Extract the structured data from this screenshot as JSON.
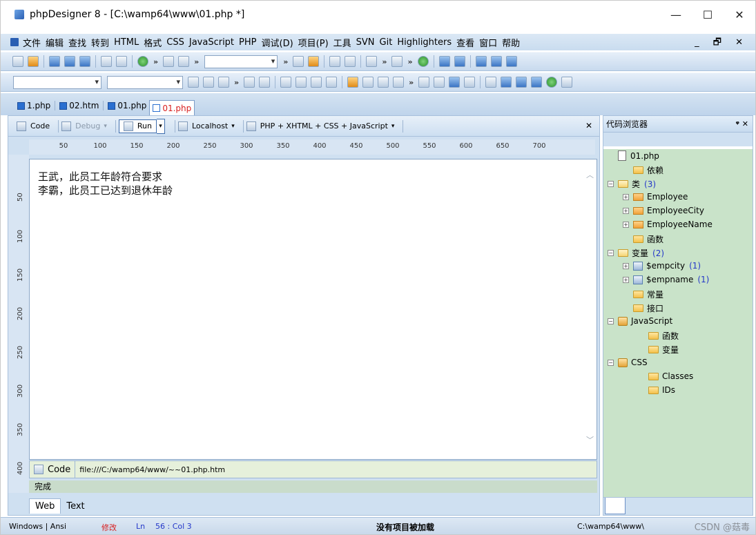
{
  "window": {
    "title": "phpDesigner 8 - [C:\\wamp64\\www\\01.php *]",
    "controls": {
      "minimize": "—",
      "maximize": "☐",
      "close": "✕"
    }
  },
  "menu": {
    "items": [
      "文件",
      "编辑",
      "查找",
      "转到",
      "HTML",
      "格式",
      "CSS",
      "JavaScript",
      "PHP",
      "调试(D)",
      "项目(P)",
      "工具",
      "SVN",
      "Git",
      "Highlighters",
      "查看",
      "窗口",
      "帮助"
    ],
    "right_controls": "_ 🗗 ✕"
  },
  "file_tabs": [
    {
      "label": "1.php",
      "active": false
    },
    {
      "label": "02.htm",
      "active": false
    },
    {
      "label": "01.php",
      "active": false
    },
    {
      "label": "01.php",
      "active": true
    }
  ],
  "editor_toolbar": {
    "code": "Code",
    "debug": "Debug",
    "run": "Run",
    "localhost": "Localhost",
    "profile": "PHP + XHTML + CSS + JavaScript",
    "close": "✕"
  },
  "ruler": {
    "horizontal": [
      "50",
      "100",
      "150",
      "200",
      "250",
      "300",
      "350",
      "400",
      "450",
      "500",
      "550",
      "600",
      "650",
      "700"
    ],
    "vertical": [
      "50",
      "100",
      "150",
      "200",
      "250",
      "300",
      "350",
      "400"
    ]
  },
  "editor": {
    "lines": [
      "王武，此员工年龄符合要求",
      "李霸，此员工已达到退休年龄"
    ]
  },
  "code_bar": {
    "label": "Code",
    "url": "file:///C:/wamp64/www/~~01.php.htm"
  },
  "status_done": "完成",
  "view_tabs": [
    "Web",
    "Text"
  ],
  "code_browser": {
    "title": "代码浏览器",
    "header_controls": "ᵠ ✕",
    "tree": [
      {
        "label": "01.php",
        "kind": "doc",
        "indent": 0
      },
      {
        "label": "依赖",
        "kind": "folder",
        "indent": 1
      },
      {
        "label": "类",
        "count": "(3)",
        "kind": "folder-open",
        "indent": 0,
        "expander": "⊟"
      },
      {
        "label": "Employee",
        "kind": "class",
        "indent": 1,
        "expander": "⊞"
      },
      {
        "label": "EmployeeCity",
        "kind": "class",
        "indent": 1,
        "expander": "⊞"
      },
      {
        "label": "EmployeeName",
        "kind": "class",
        "indent": 1,
        "expander": "⊞"
      },
      {
        "label": "函数",
        "kind": "folder",
        "indent": 1
      },
      {
        "label": "变量",
        "count": "(2)",
        "kind": "folder-open",
        "indent": 0,
        "expander": "⊟"
      },
      {
        "label": "$empcity",
        "count": "(1)",
        "kind": "var",
        "indent": 1,
        "expander": "⊞"
      },
      {
        "label": "$empname",
        "count": "(1)",
        "kind": "var",
        "indent": 1,
        "expander": "⊞"
      },
      {
        "label": "常量",
        "kind": "folder",
        "indent": 1
      },
      {
        "label": "接口",
        "kind": "folder",
        "indent": 1
      },
      {
        "label": "JavaScript",
        "kind": "js",
        "indent": 0,
        "expander": "⊟"
      },
      {
        "label": "函数",
        "kind": "folder",
        "indent": 2
      },
      {
        "label": "变量",
        "kind": "folder",
        "indent": 2
      },
      {
        "label": "CSS",
        "kind": "js",
        "indent": 0,
        "expander": "⊟"
      },
      {
        "label": "Classes",
        "kind": "folder",
        "indent": 2
      },
      {
        "label": "IDs",
        "kind": "folder",
        "indent": 2
      }
    ]
  },
  "statusbar": {
    "encoding": "Windows | Ansi",
    "modified": "修改",
    "ln_label": "Ln",
    "ln_col": "56 : Col  3",
    "project": "没有项目被加载",
    "path": "C:\\wamp64\\www\\",
    "watermark": "CSDN @菇毒"
  }
}
